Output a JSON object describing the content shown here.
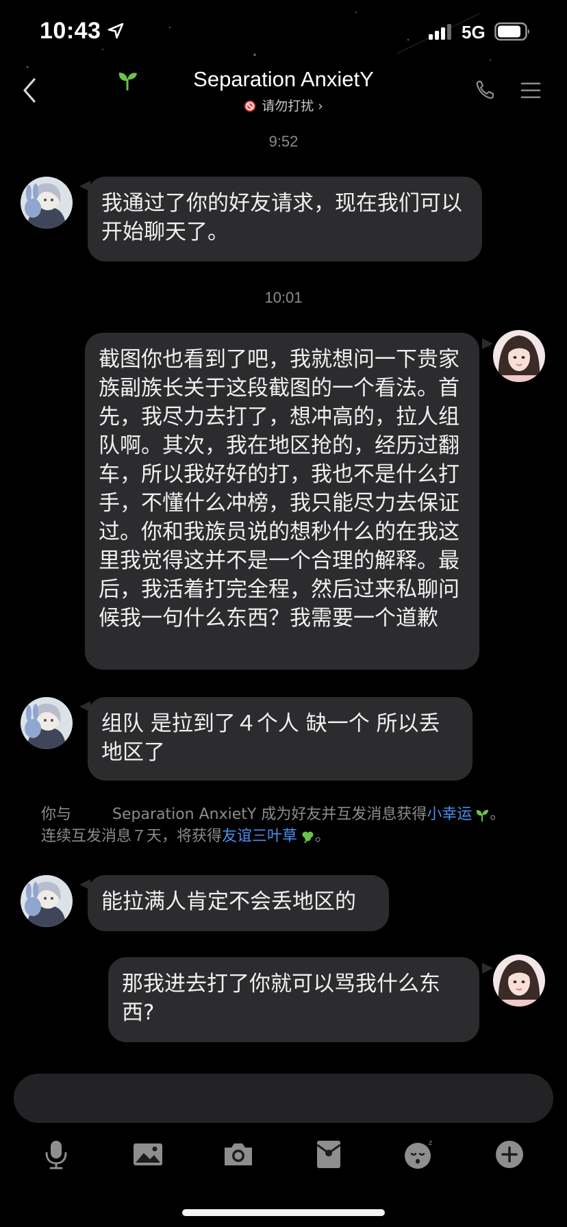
{
  "status_bar": {
    "time": "10:43",
    "network": "5G"
  },
  "nav": {
    "title": "Separation AnxietY",
    "dnd_label": "请勿打扰",
    "dnd_chevron": "›"
  },
  "icons": {
    "back": "back-chevron-icon",
    "sprout": "sprout-icon",
    "call": "phone-icon",
    "menu": "menu-icon",
    "voice": "microphone-icon",
    "image": "image-icon",
    "camera": "camera-icon",
    "red_packet": "red-packet-icon",
    "emoji": "emoji-icon",
    "more": "plus-icon"
  },
  "colors": {
    "background": "#000000",
    "bubble": "#2c2c2e",
    "link": "#4a8ff0",
    "sprout": "#6cc24a",
    "dnd": "#e5484d"
  },
  "conversation": {
    "time_1": "9:52",
    "time_2": "10:01",
    "msg_1": "我通过了你的好友请求，现在我们可以开始聊天了。",
    "msg_2": "截图你也看到了吧，我就想问一下贵家族副族长关于这段截图的一个看法。首先，我尽力去打了，想冲高的，拉人组队啊。其次，我在地区抢的，经历过翻车，所以我好好的打，我也不是什么打手，不懂什么冲榜，我只能尽力去保证过。你和我族员说的想秒什么的在我这里我觉得这并不是一个合理的解释。最后，我活着打完全程，然后过来私聊问候我一句什么东西？我需要一个道歉",
    "msg_3": "组队 是拉到了４个人 缺一个 所以丢地区了",
    "msg_4": "能拉满人肯定不会丢地区的",
    "msg_5": "那我进去打了你就可以骂我什么东西?"
  },
  "system": {
    "part_1": "你与",
    "part_2": "Separation AnxietY 成为好友并互发消息获得",
    "link_1": "小幸运",
    "part_3": "。",
    "part_4": "连续互发消息７天，将获得",
    "link_2": "友谊三叶草",
    "part_5": "。"
  }
}
